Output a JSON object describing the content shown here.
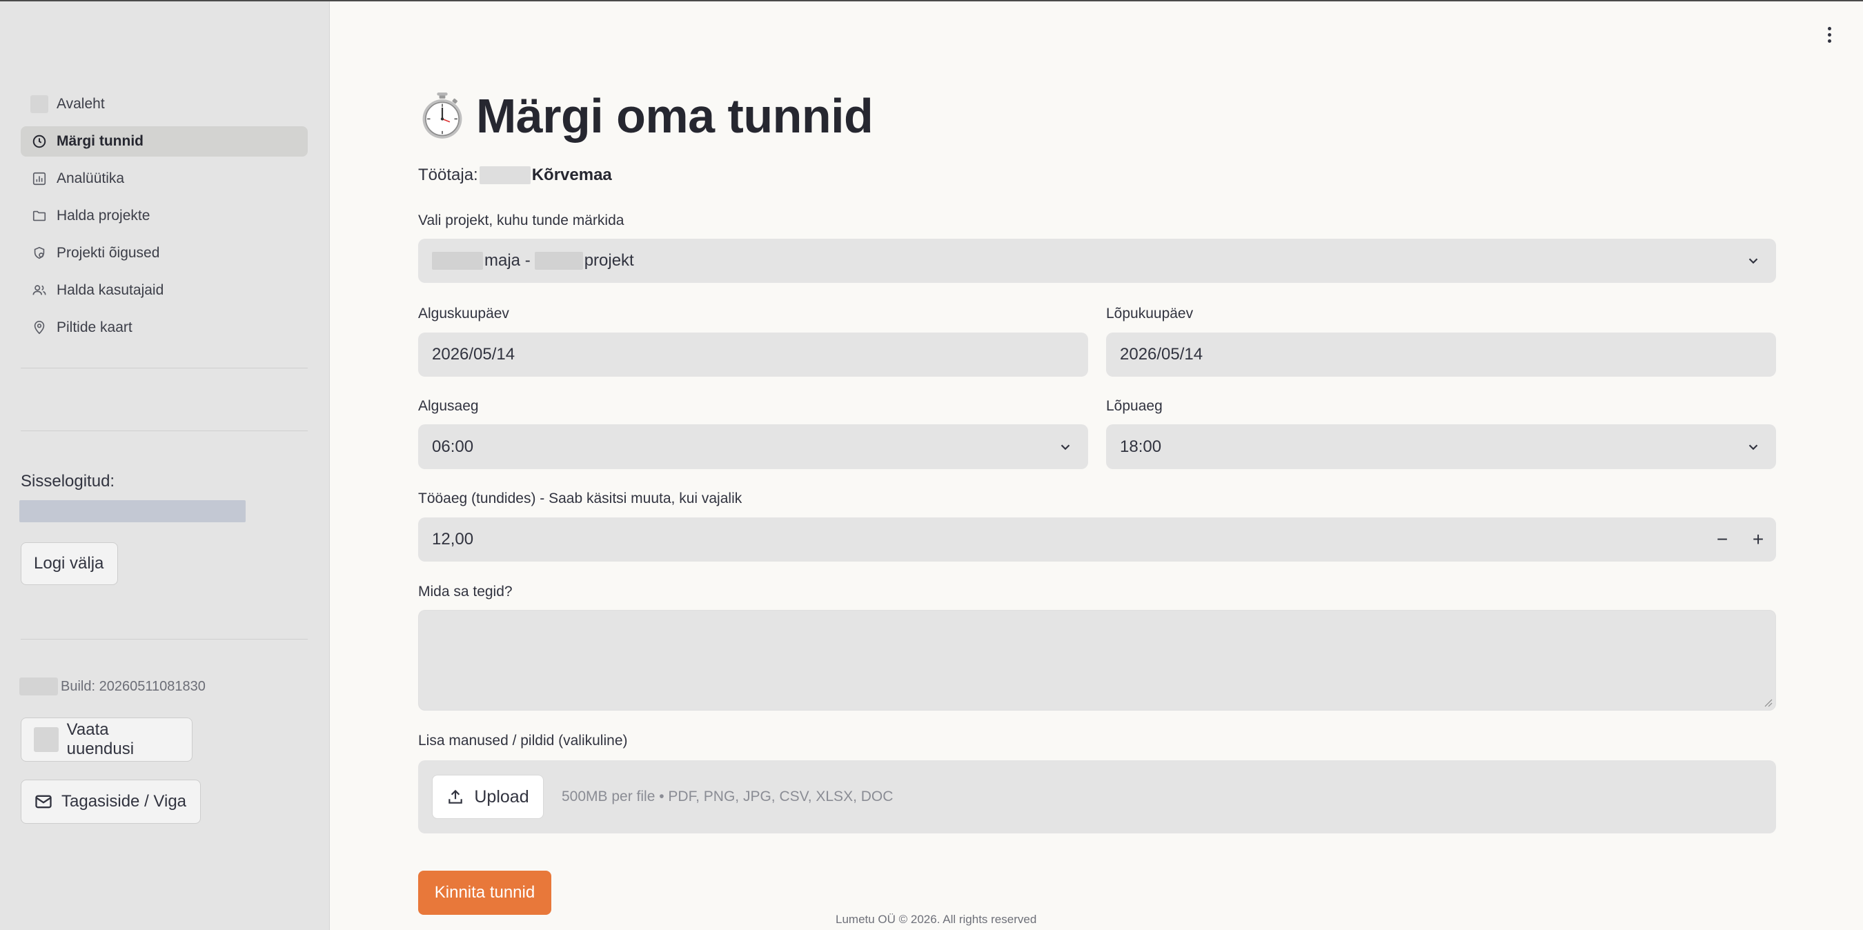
{
  "sidebar": {
    "nav": [
      {
        "label": "Avaleht",
        "icon": "home-icon"
      },
      {
        "label": "Märgi tunnid",
        "icon": "clock-icon",
        "active": true
      },
      {
        "label": "Analüütika",
        "icon": "bar-chart-icon"
      },
      {
        "label": "Halda projekte",
        "icon": "folder-icon"
      },
      {
        "label": "Projekti õigused",
        "icon": "shield-user-icon"
      },
      {
        "label": "Halda kasutajaid",
        "icon": "users-icon"
      },
      {
        "label": "Piltide kaart",
        "icon": "map-pin-icon"
      }
    ],
    "logged_in_label": "Sisselogitud:",
    "logout_label": "Logi välja",
    "build_label": "Build: 20260511081830",
    "updates_label": "Vaata uuendusi",
    "feedback_label": "Tagasiside / Viga"
  },
  "page": {
    "title": "Märgi oma tunnid",
    "title_icon": "stopwatch-icon",
    "worker_prefix": "Töötaja:",
    "worker_name": "Kõrvemaa"
  },
  "form": {
    "project_label": "Vali projekt, kuhu tunde märkida",
    "project_part1": "maja -",
    "project_part2": "projekt",
    "start_date_label": "Alguskuupäev",
    "start_date_value": "2026/05/14",
    "end_date_label": "Lõpukuupäev",
    "end_date_value": "2026/05/14",
    "start_time_label": "Algusaeg",
    "start_time_value": "06:00",
    "end_time_label": "Lõpuaeg",
    "end_time_value": "18:00",
    "hours_label": "Tööaeg (tundides) - Saab käsitsi muuta, kui vajalik",
    "hours_value": "12,00",
    "stepper_minus": "−",
    "stepper_plus": "+",
    "description_label": "Mida sa tegid?",
    "attachments_label": "Lisa manused / pildid (valikuline)",
    "upload_label": "Upload",
    "upload_hint": "500MB per file • PDF, PNG, JPG, CSV, XLSX, DOC",
    "submit_label": "Kinnita tunnid"
  },
  "footer": {
    "text": "Lumetu OÜ © 2026. All rights reserved"
  }
}
